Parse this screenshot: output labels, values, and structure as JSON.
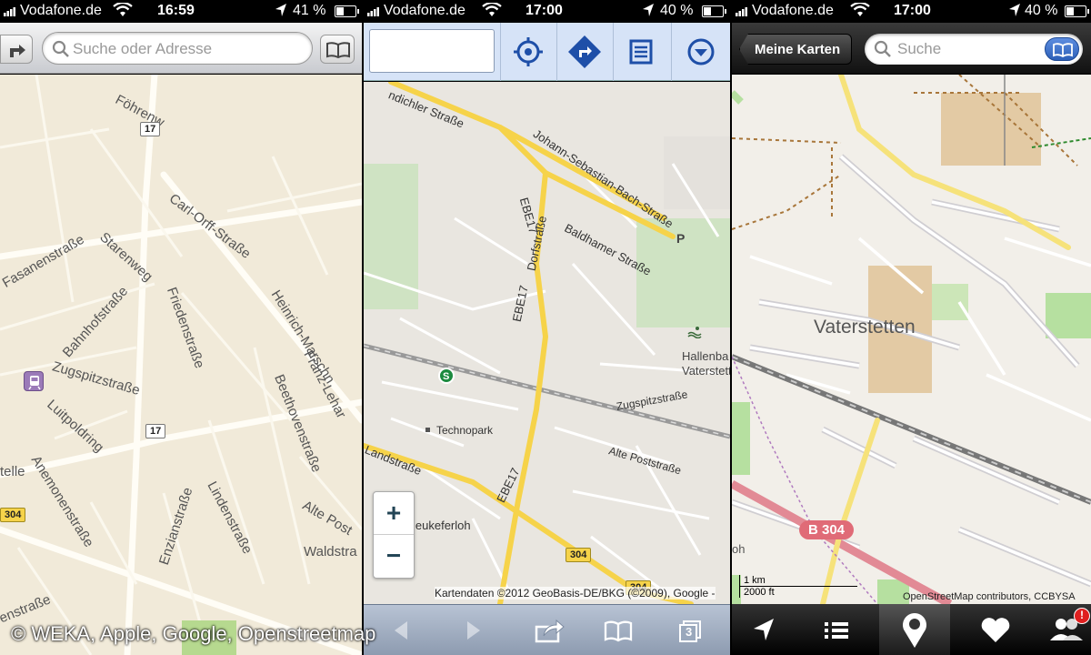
{
  "panels": [
    {
      "status": {
        "carrier": "Vodafone.de",
        "time": "16:59",
        "battery": "41 %"
      },
      "search": {
        "placeholder": "Suche oder Adresse"
      },
      "map": {
        "labels": [
          "Föhrenw",
          "Carl-Orff-Straße",
          "Starenweg",
          "Fasanenstraße",
          "Bahnhofstraße",
          "Friedenstraße",
          "Heinrich-Marschn",
          "Franz-Lehar",
          "Zugspitzstraße",
          "Beethovenstraße",
          "Luitpoldring",
          "Anemonenstraße",
          "Lindenstraße",
          "Enzianstraße",
          "Alte Post",
          "Waldstra",
          "telle",
          "enstraße"
        ],
        "shields": [
          "17",
          "17",
          "304"
        ]
      }
    },
    {
      "status": {
        "carrier": "Vodafone.de",
        "time": "17:00",
        "battery": "40 %"
      },
      "map": {
        "labels": [
          "ndichler Straße",
          "Johann-Sebastian-Bach-Straße",
          "Baldhamer Straße",
          "EBE17",
          "Dorfstraße",
          "EBE17",
          "Hallenba",
          "Vaterstetter",
          "Technopark",
          "Zugspitzstraße",
          "Alte Poststraße",
          "Landstraße",
          "EBE17",
          "leukeferloh",
          "P"
        ],
        "shields": [
          "304",
          "304"
        ],
        "attribution": "Kartendaten ©2012 GeoBasis-DE/BKG (©2009), Google -"
      },
      "zoom": {
        "in": "+",
        "out": "−"
      },
      "tabs_count": "3"
    },
    {
      "status": {
        "carrier": "Vodafone.de",
        "time": "17:00",
        "battery": "40 %"
      },
      "back_label": "Meine Karten",
      "search": {
        "placeholder": "Suche"
      },
      "map": {
        "city": "Vaterstetten",
        "road_shield": "B 304",
        "scale_km": "1 km",
        "scale_ft": "2000 ft",
        "attribution": "OpenStreetMap contributors, CCBYSA",
        "edge_label": "oh"
      }
    }
  ],
  "watermark": "© WEKA, Apple, Google, Openstreetmap"
}
